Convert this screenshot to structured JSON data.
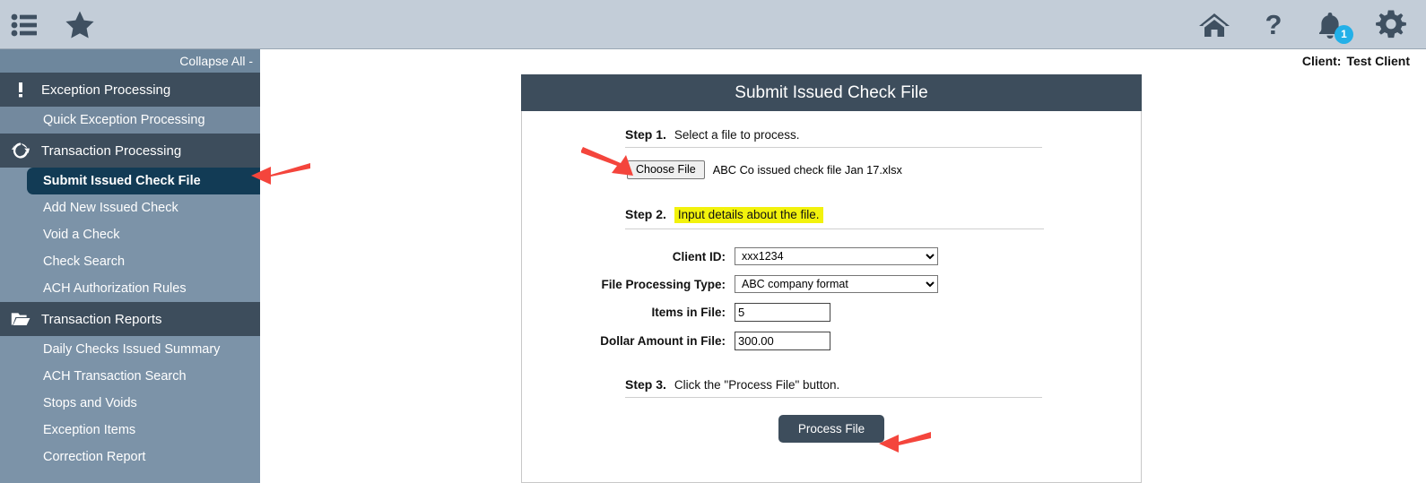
{
  "topbar": {
    "left_icons": [
      {
        "name": "menu-list-icon",
        "label": "Menu"
      },
      {
        "name": "favorites-star-icon",
        "label": "Favorites"
      }
    ],
    "right_icons": [
      {
        "name": "home-icon",
        "label": "Home"
      },
      {
        "name": "help-icon",
        "label": "Help"
      },
      {
        "name": "notifications-bell-icon",
        "label": "Notifications"
      },
      {
        "name": "settings-gear-icon",
        "label": "Settings"
      }
    ],
    "notification_count": "1"
  },
  "client_bar": {
    "key": "Client:",
    "value": "Test Client"
  },
  "sidebar": {
    "collapse_all": "Collapse All -",
    "groups": [
      {
        "label": "Exception Processing",
        "icon": "exclamation-icon",
        "items": [
          {
            "label": "Quick Exception Processing",
            "selected": false
          }
        ]
      },
      {
        "label": "Transaction Processing",
        "icon": "refresh-cycle-icon",
        "items": [
          {
            "label": "Submit Issued Check File",
            "selected": true
          },
          {
            "label": "Add New Issued Check",
            "selected": false
          },
          {
            "label": "Void a Check",
            "selected": false
          },
          {
            "label": "Check Search",
            "selected": false
          },
          {
            "label": "ACH Authorization Rules",
            "selected": false
          }
        ]
      },
      {
        "label": "Transaction Reports",
        "icon": "folder-open-icon",
        "items": [
          {
            "label": "Daily Checks Issued Summary",
            "selected": false
          },
          {
            "label": "ACH Transaction Search",
            "selected": false
          },
          {
            "label": "Stops and Voids",
            "selected": false
          },
          {
            "label": "Exception Items",
            "selected": false
          },
          {
            "label": "Correction Report",
            "selected": false
          }
        ]
      }
    ]
  },
  "panel": {
    "title": "Submit Issued Check File",
    "step1": {
      "num": "Step 1.",
      "text": "Select a file to process.",
      "choose_button": "Choose File",
      "file_name": "ABC Co issued check file Jan 17.xlsx"
    },
    "step2": {
      "num": "Step 2.",
      "text": "Input details about the file.",
      "fields": [
        {
          "label": "Client ID:",
          "value": "xxx1234",
          "type": "select",
          "name": "client-id-select"
        },
        {
          "label": "File Processing Type:",
          "value": "ABC company format",
          "type": "select",
          "name": "file-processing-type-select"
        },
        {
          "label": "Items in File:",
          "value": "5",
          "type": "input",
          "name": "items-in-file-input"
        },
        {
          "label": "Dollar Amount in File:",
          "value": "300.00",
          "type": "input",
          "name": "dollar-amount-in-file-input"
        }
      ]
    },
    "step3": {
      "num": "Step 3.",
      "text": "Click the \"Process File\" button.",
      "process_button": "Process File"
    }
  },
  "colors": {
    "topbar_bg": "#c3cdd8",
    "sidebar_bg": "#7c93a8",
    "group_bg": "#3d4d5c",
    "selected_item_bg": "#123b55",
    "accent_badge": "#23b0e8",
    "highlight_yellow": "#f2f20c",
    "arrow_red": "#f4453c"
  }
}
